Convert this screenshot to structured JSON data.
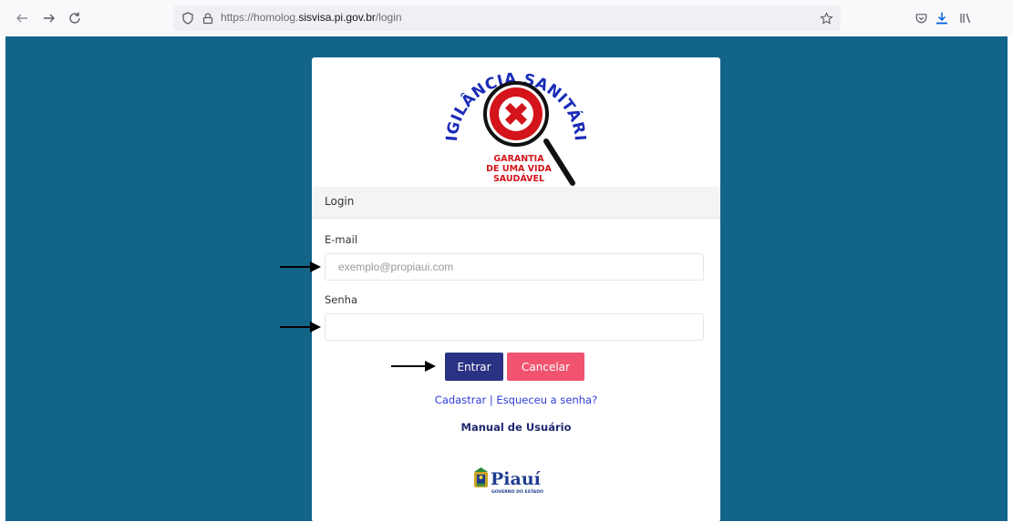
{
  "browser": {
    "url_prefix": "https://homolog.",
    "url_host": "sisvisa.pi.gov.br",
    "url_path": "/login"
  },
  "logo": {
    "arc_text": "VIGILÂNCIA SANITÁRIA",
    "slogan_line1": "GARANTIA",
    "slogan_line2": "DE UMA VIDA",
    "slogan_line3": "SAUDÁVEL"
  },
  "login": {
    "header": "Login",
    "email_label": "E-mail",
    "email_placeholder": "exemplo@propiaui.com",
    "email_value": "",
    "password_label": "Senha",
    "password_value": "",
    "submit_label": "Entrar",
    "cancel_label": "Cancelar",
    "register_link": "Cadastrar",
    "link_separator": " | ",
    "forgot_link": "Esqueceu a senha?",
    "manual_link": "Manual de Usuário"
  },
  "footer_logo": {
    "name": "Piauí",
    "subtitle": "GOVERNO DO ESTADO"
  },
  "colors": {
    "page_background": "#136489",
    "primary_button": "#2a3283",
    "cancel_button": "#f0546f",
    "link": "#2d3bd6",
    "logo_red": "#d3141b",
    "logo_blue": "#1a2cb8"
  },
  "icons": [
    "back-arrow-icon",
    "forward-arrow-icon",
    "reload-icon",
    "shield-icon",
    "lock-icon",
    "star-icon",
    "pocket-icon",
    "download-icon",
    "library-icon"
  ]
}
